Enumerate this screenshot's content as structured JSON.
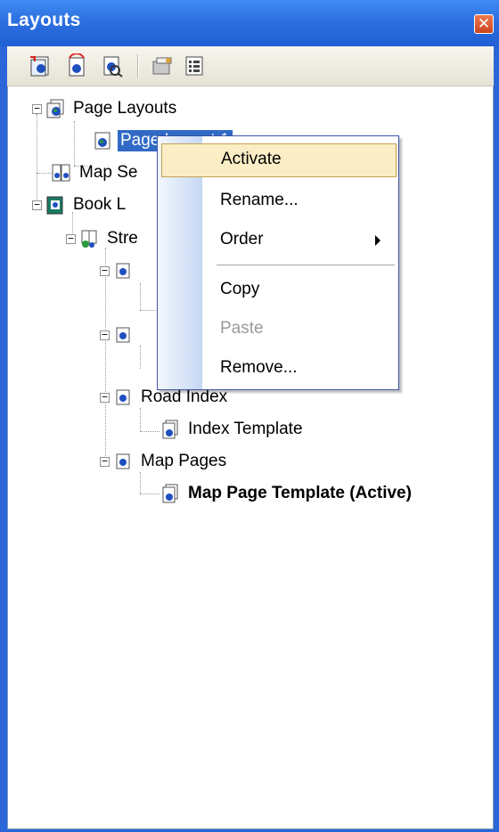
{
  "window": {
    "title": "Layouts",
    "close_symbol": "✕"
  },
  "toolbar": {
    "buttons": [
      "new-page-layout-icon",
      "new-map-series-icon",
      "new-book-icon",
      "properties-icon",
      "options-icon"
    ]
  },
  "tree": {
    "page_layouts": {
      "label": "Page Layouts",
      "expander": "−"
    },
    "page_layout_1": {
      "label": "Page Layout 1"
    },
    "map_series": {
      "label": "Map Se"
    },
    "book": {
      "label": "Book L",
      "expander": "−"
    },
    "street": {
      "label": "Stre",
      "expander": "−"
    },
    "road_index": {
      "label": "Road Index",
      "expander": "−"
    },
    "index_template": {
      "label": "Index Template"
    },
    "map_pages": {
      "label": "Map Pages",
      "expander": "−"
    },
    "map_page_template": {
      "label": "Map Page Template (Active)"
    }
  },
  "context_menu": {
    "items": [
      {
        "label": "Activate",
        "state": "highlighted"
      },
      {
        "label": "Rename..."
      },
      {
        "label": "Order",
        "submenu": true
      },
      {
        "label": "Copy"
      },
      {
        "label": "Paste",
        "state": "disabled"
      },
      {
        "label": "Remove..."
      }
    ]
  },
  "colors": {
    "title_bar": "#2d6fe0",
    "selection": "#316ac5",
    "menu_highlight": "#fbeec6"
  }
}
